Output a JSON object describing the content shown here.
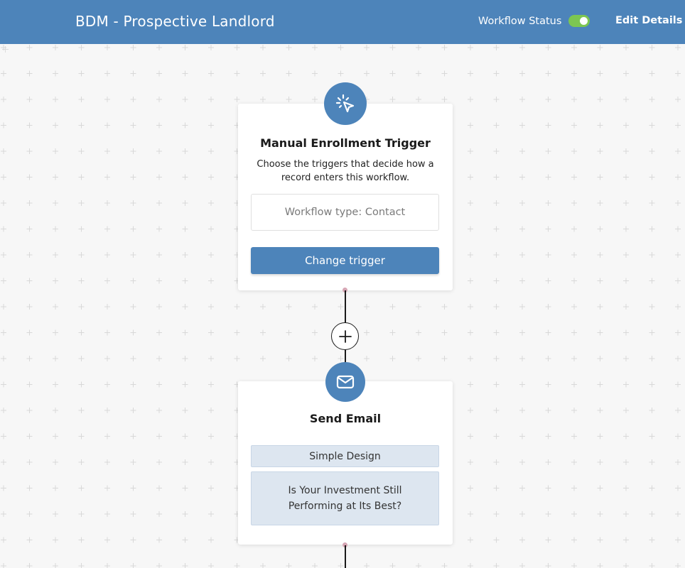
{
  "header": {
    "title": "BDM - Prospective Landlord",
    "status_label": "Workflow Status",
    "status_on": true,
    "edit_label": "Edit Details"
  },
  "trigger_card": {
    "icon": "cursor-click-icon",
    "title": "Manual Enrollment Trigger",
    "description": "Choose the triggers that decide how a record enters this workflow.",
    "workflow_type": "Workflow type: Contact",
    "button_label": "Change trigger"
  },
  "add_step": {
    "icon": "plus-icon"
  },
  "email_card": {
    "icon": "envelope-icon",
    "title": "Send Email",
    "design": "Simple Design",
    "subject": "Is Your Investment Still Performing at Its Best?"
  },
  "colors": {
    "header_bg": "#4d84ba",
    "toggle_on": "#7cc651",
    "primary_button": "#4d84ba",
    "info_box_bg": "#dde6f0"
  }
}
